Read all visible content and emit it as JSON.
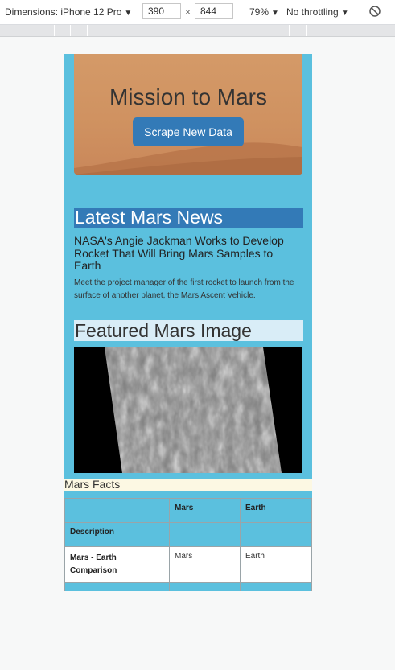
{
  "devtools": {
    "device_label": "Dimensions: iPhone 12 Pro",
    "width": "390",
    "height": "844",
    "times": "×",
    "zoom": "79%",
    "throttling": "No throttling"
  },
  "jumbotron": {
    "title": "Mission to Mars",
    "button_label": "Scrape New Data"
  },
  "news": {
    "heading": "Latest Mars News",
    "title": "NASA's Angie Jackman Works to Develop Rocket That Will Bring Mars Samples to Earth",
    "paragraph": "Meet the project manager of the first rocket to launch from the surface of another planet, the Mars Ascent Vehicle."
  },
  "featured": {
    "heading": "Featured Mars Image"
  },
  "facts": {
    "heading": "Mars Facts",
    "columns": [
      "",
      "Mars",
      "Earth"
    ],
    "rows": [
      {
        "label": "Description",
        "mars": "",
        "earth": ""
      },
      {
        "label": "Mars - Earth Comparison",
        "mars": "Mars",
        "earth": "Earth"
      }
    ]
  },
  "colors": {
    "page_bg": "#5bc0de",
    "news_heading_bg": "#337ab7",
    "featured_heading_bg": "#d9edf7",
    "facts_heading_bg": "#fcf8e3",
    "button_bg": "#337ab7"
  }
}
